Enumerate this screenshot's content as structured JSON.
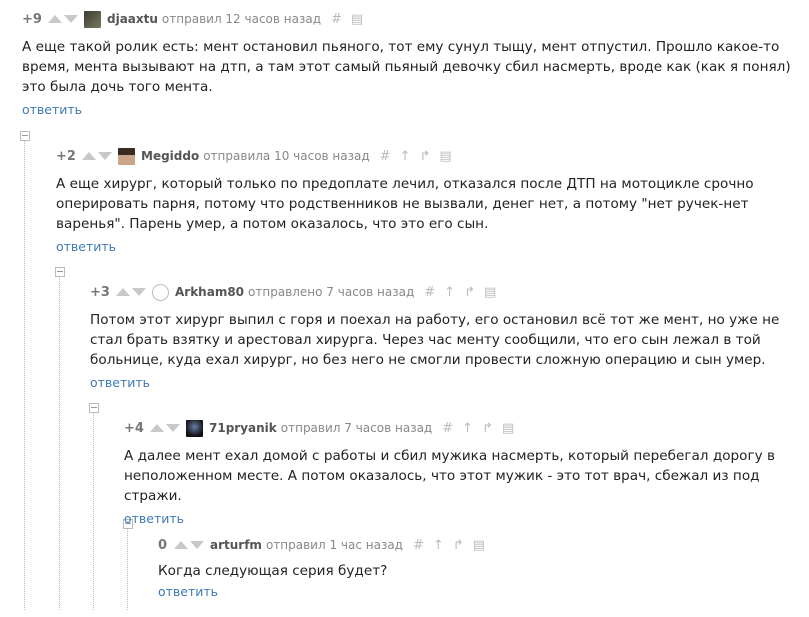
{
  "comments": [
    {
      "rating": "+9",
      "author": "djaaxtu",
      "meta": "отправил 12 часов назад",
      "text": "А еще такой ролик есть: мент остановил пьяного, тот ему сунул тыщу, мент отпустил. Прошло какое-то время, мента вызывают на дтп, а там этот самый пьяный девочку сбил насмерть, вроде как (как я понял) это была дочь того мента.",
      "reply": "ответить"
    },
    {
      "rating": "+2",
      "author": "Megiddo",
      "meta": "отправила 10 часов назад",
      "text": "А еще хирург, который только по предоплате лечил, отказался после ДТП на мотоцикле срочно оперировать парня, потому что родственников не вызвали, денег нет, а потому \"нет ручек-нет варенья\". Парень умер, а потом оказалось, что это его сын.",
      "reply": "ответить"
    },
    {
      "rating": "+3",
      "author": "Arkham80",
      "meta": "отправлено 7 часов назад",
      "text": "Потом этот хирург выпил с горя и поехал на работу, его остановил всё тот же мент, но уже не стал брать взятку и арестовал хирурга. Через час менту сообщили, что его сын лежал в той больнице, куда ехал хирург, но без него не смогли провести сложную операцию и сын умер.",
      "reply": "ответить"
    },
    {
      "rating": "+4",
      "author": "71pryanik",
      "meta": "отправил 7 часов назад",
      "text": "А далее мент ехал домой с работы и сбил мужика насмерть, который перебегал дорогу в неположенном месте. А потом оказалось, что этот мужик - это тот врач, сбежал из под стражи.",
      "reply": "ответить"
    },
    {
      "rating": "0",
      "author": "arturfm",
      "meta": "отправил 1 час назад",
      "text": "Когда следующая серия будет?",
      "reply": "ответить"
    }
  ],
  "icons": {
    "link": "#",
    "save": "save-icon",
    "up_arrow": "arrow-up-icon",
    "branch": "branch-icon"
  },
  "colors": {
    "link": "#3d7ab8",
    "author": "#555555",
    "meta": "#888888"
  }
}
